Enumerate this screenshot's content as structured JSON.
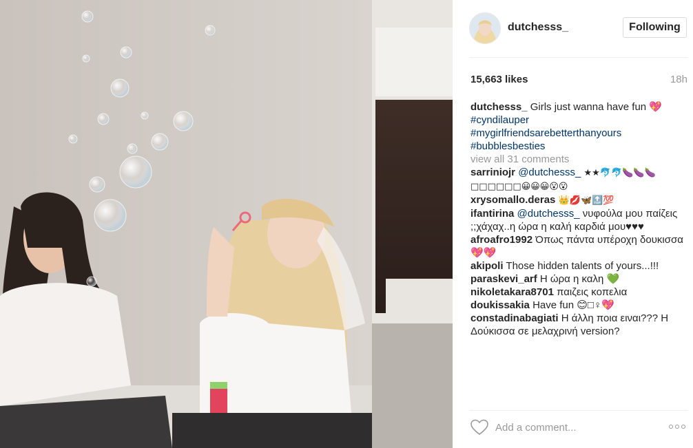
{
  "post": {
    "username": "dutchesss_",
    "follow_label": "Following",
    "likes": "15,663 likes",
    "time": "18h"
  },
  "caption": {
    "user": "dutchesss_",
    "text": "Girls just wanna have fun 💖",
    "hashtags": [
      "#cyndilauper",
      "#mygirlfriendsarebetterthanyours",
      "#bubblesbesties"
    ]
  },
  "view_all": "view all 31 comments",
  "comments": [
    {
      "user": "sarriniojr",
      "mention": "@dutchesss_",
      "text": "★★🐬🐬🍆🍆🍆 □□□□□□😀😀😀😮😮"
    },
    {
      "user": "xrysomallo.deras",
      "mention": "",
      "text": "👑💋🦋🔝💯"
    },
    {
      "user": "ifantirina",
      "mention": "@dutchesss_",
      "text": "νυφούλα μου παίζεις ;;χάχαχ..η ώρα η καλή καρδιά μου♥♥♥"
    },
    {
      "user": "afroafro1992",
      "mention": "",
      "text": "Όπως πάντα υπέροχη δουκισσα💖💖"
    },
    {
      "user": "akipoli",
      "mention": "",
      "text": "Those hidden talents of yours...!!!"
    },
    {
      "user": "paraskevi_arf",
      "mention": "",
      "text": "Η ώρα η καλη 💚"
    },
    {
      "user": "nikoletakara8701",
      "mention": "",
      "text": "παιζεις κοπελια"
    },
    {
      "user": "doukissakia",
      "mention": "",
      "text": "Have fun 😊□♀💖"
    },
    {
      "user": "constadinabagiati",
      "mention": "",
      "text": "Η άλλη ποια ειναι??? Η Δούκισσα σε μελαχρινή version?"
    }
  ],
  "add_comment": {
    "placeholder": "Add a comment..."
  },
  "icons": {
    "like": "heart-icon",
    "more": "more-options-icon",
    "avatar": "avatar"
  },
  "colors": {
    "link": "#003569",
    "muted": "#999999",
    "border": "#dbdbdb"
  }
}
